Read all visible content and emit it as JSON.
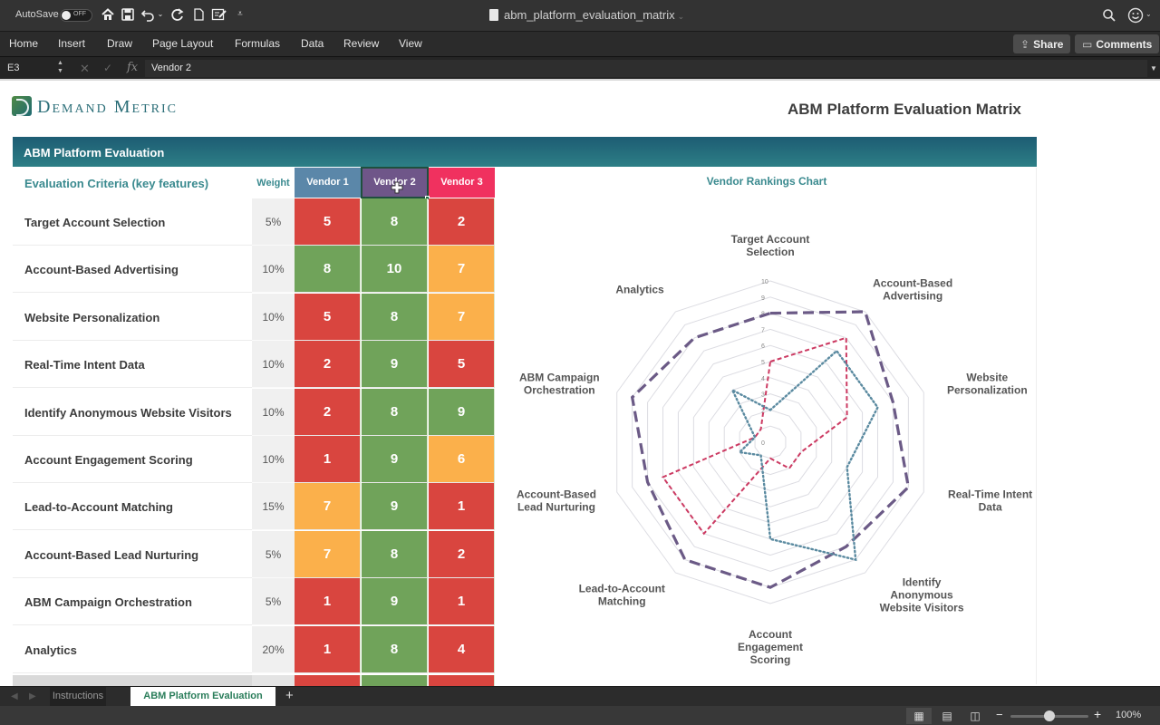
{
  "titlebar": {
    "autosave_label": "AutoSave",
    "autosave_state": "OFF",
    "document_title": "abm_platform_evaluation_matrix",
    "quick_access": [
      "home-icon",
      "save-icon",
      "undo-icon",
      "redo-icon",
      "new-document-icon",
      "edit-document-icon",
      "customize-icon"
    ]
  },
  "ribbon": {
    "tabs": [
      "Home",
      "Insert",
      "Draw",
      "Page Layout",
      "Formulas",
      "Data",
      "Review",
      "View"
    ],
    "share_label": "Share",
    "comments_label": "Comments"
  },
  "formula_bar": {
    "cell_reference": "E3",
    "fx_label": "fx",
    "formula_value": "Vendor 2"
  },
  "sheet": {
    "brand": "Demand Metric",
    "title": "ABM Platform Evaluation Matrix",
    "section_title": "ABM Platform Evaluation",
    "criteria_header": "Evaluation Criteria (key features)",
    "weight_header": "Weight",
    "vendors": [
      {
        "name": "Vendor 1",
        "color": "#5b87a9"
      },
      {
        "name": "Vendor 2",
        "color": "#6f5689"
      },
      {
        "name": "Vendor 3",
        "color": "#f0315f"
      }
    ],
    "score_colors": {
      "low": "#d9453f",
      "mid": "#fbb04b",
      "high": "#70a35a"
    },
    "rows": [
      {
        "criterion": "Target Account Selection",
        "weight": "5%",
        "scores": [
          "5",
          "8",
          "2"
        ],
        "levels": [
          "low",
          "high",
          "low"
        ]
      },
      {
        "criterion": "Account-Based Advertising",
        "weight": "10%",
        "scores": [
          "8",
          "10",
          "7"
        ],
        "levels": [
          "high",
          "high",
          "mid"
        ]
      },
      {
        "criterion": "Website Personalization",
        "weight": "10%",
        "scores": [
          "5",
          "8",
          "7"
        ],
        "levels": [
          "low",
          "high",
          "mid"
        ]
      },
      {
        "criterion": "Real-Time Intent Data",
        "weight": "10%",
        "scores": [
          "2",
          "9",
          "5"
        ],
        "levels": [
          "low",
          "high",
          "low"
        ]
      },
      {
        "criterion": "Identify Anonymous Website Visitors",
        "weight": "10%",
        "scores": [
          "2",
          "8",
          "9"
        ],
        "levels": [
          "low",
          "high",
          "high"
        ]
      },
      {
        "criterion": "Account Engagement Scoring",
        "weight": "10%",
        "scores": [
          "1",
          "9",
          "6"
        ],
        "levels": [
          "low",
          "high",
          "mid"
        ]
      },
      {
        "criterion": "Lead-to-Account Matching",
        "weight": "15%",
        "scores": [
          "7",
          "9",
          "1"
        ],
        "levels": [
          "mid",
          "high",
          "low"
        ]
      },
      {
        "criterion": "Account-Based Lead Nurturing",
        "weight": "5%",
        "scores": [
          "7",
          "8",
          "2"
        ],
        "levels": [
          "mid",
          "high",
          "low"
        ]
      },
      {
        "criterion": "ABM Campaign Orchestration",
        "weight": "5%",
        "scores": [
          "1",
          "9",
          "1"
        ],
        "levels": [
          "low",
          "high",
          "low"
        ]
      },
      {
        "criterion": "Analytics",
        "weight": "20%",
        "scores": [
          "1",
          "8",
          "4"
        ],
        "levels": [
          "low",
          "high",
          "low"
        ]
      }
    ]
  },
  "chart_data": {
    "type": "radar",
    "title": "Vendor Rankings Chart",
    "categories": [
      [
        "Target Account",
        "Selection"
      ],
      [
        "Account-Based",
        "Advertising"
      ],
      [
        "Website",
        "Personalization"
      ],
      [
        "Real-Time Intent",
        "Data"
      ],
      [
        "Identify",
        "Anonymous",
        "Website Visitors"
      ],
      [
        "Account",
        "Engagement",
        "Scoring"
      ],
      [
        "Lead-to-Account",
        "Matching"
      ],
      [
        "Account-Based",
        "Lead Nurturing"
      ],
      [
        "ABM Campaign",
        "Orchestration"
      ],
      [
        "Analytics"
      ]
    ],
    "rlim": [
      0,
      10
    ],
    "ticks": [
      0,
      2,
      3,
      4,
      5,
      6,
      7,
      8,
      9,
      10
    ],
    "grid": true,
    "series": [
      {
        "name": "Vendor 1",
        "values": [
          5,
          8,
          5,
          2,
          2,
          1,
          7,
          7,
          1,
          1
        ],
        "color": "#cc3a62",
        "style": "dashed"
      },
      {
        "name": "Vendor 2",
        "values": [
          8,
          10,
          8,
          9,
          8,
          9,
          9,
          8,
          9,
          8
        ],
        "color": "#6b5a86",
        "style": "long-dash"
      },
      {
        "name": "Vendor 3",
        "values": [
          2,
          7,
          7,
          5,
          9,
          6,
          1,
          2,
          1,
          4
        ],
        "color": "#5a8aa0",
        "style": "dotted"
      }
    ]
  },
  "sheet_tabs": {
    "tabs": [
      "Instructions",
      "ABM Platform Evaluation"
    ],
    "active": "ABM Platform Evaluation"
  },
  "status_bar": {
    "zoom_percent": "100%",
    "zoom_level": 0.5
  }
}
